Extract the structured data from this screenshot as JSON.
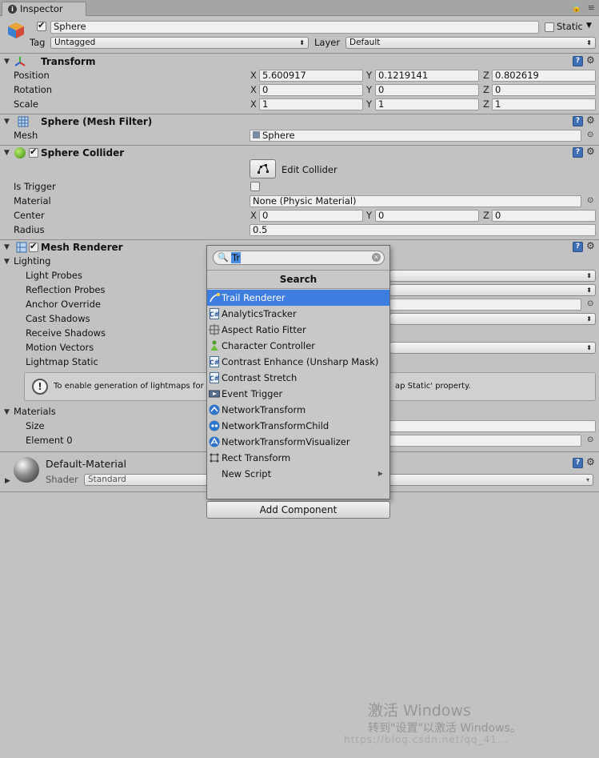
{
  "window": {
    "tab_label": "Inspector"
  },
  "object": {
    "name": "Sphere",
    "static_label": "Static",
    "tag_label": "Tag",
    "tag_value": "Untagged",
    "layer_label": "Layer",
    "layer_value": "Default"
  },
  "transform": {
    "title": "Transform",
    "rows": [
      {
        "label": "Position",
        "x": "5.600917",
        "y": "0.1219141",
        "z": "0.802619"
      },
      {
        "label": "Rotation",
        "x": "0",
        "y": "0",
        "z": "0"
      },
      {
        "label": "Scale",
        "x": "1",
        "y": "1",
        "z": "1"
      }
    ],
    "axes": {
      "x": "X",
      "y": "Y",
      "z": "Z"
    }
  },
  "mesh_filter": {
    "title": "Sphere (Mesh Filter)",
    "mesh_label": "Mesh",
    "mesh_value": "Sphere"
  },
  "sphere_collider": {
    "title": "Sphere Collider",
    "edit_label": "Edit Collider",
    "is_trigger_label": "Is Trigger",
    "material_label": "Material",
    "material_value": "None (Physic Material)",
    "center_label": "Center",
    "center": {
      "x": "0",
      "y": "0",
      "z": "0"
    },
    "radius_label": "Radius",
    "radius_value": "0.5"
  },
  "mesh_renderer": {
    "title": "Mesh Renderer",
    "lighting_label": "Lighting",
    "light_probes": "Light Probes",
    "reflection_probes": "Reflection Probes",
    "anchor_override": "Anchor Override",
    "cast_shadows": "Cast Shadows",
    "receive_shadows": "Receive Shadows",
    "motion_vectors": "Motion Vectors",
    "lightmap_static": "Lightmap Static",
    "info_left": "To enable generation of lightmaps for t",
    "info_right": "ap Static' property.",
    "materials_label": "Materials",
    "size_label": "Size",
    "element0_label": "Element 0"
  },
  "material": {
    "name": "Default-Material",
    "shader_label": "Shader",
    "shader_value": "Standard"
  },
  "popup": {
    "search_value": "Tr",
    "header": "Search",
    "items": [
      {
        "label": "Trail Renderer",
        "icon": "trail-renderer-icon",
        "selected": true
      },
      {
        "label": "AnalyticsTracker",
        "icon": "script-icon"
      },
      {
        "label": "Aspect Ratio Fitter",
        "icon": "aspect-ratio-icon"
      },
      {
        "label": "Character Controller",
        "icon": "character-controller-icon"
      },
      {
        "label": "Contrast Enhance (Unsharp Mask)",
        "icon": "script-icon"
      },
      {
        "label": "Contrast Stretch",
        "icon": "script-icon"
      },
      {
        "label": "Event Trigger",
        "icon": "event-trigger-icon"
      },
      {
        "label": "NetworkTransform",
        "icon": "network-icon"
      },
      {
        "label": "NetworkTransformChild",
        "icon": "network-icon"
      },
      {
        "label": "NetworkTransformVisualizer",
        "icon": "network-icon"
      },
      {
        "label": "Rect Transform",
        "icon": "rect-transform-icon"
      },
      {
        "label": "New Script",
        "icon": "",
        "submenu": true
      }
    ],
    "add_component": "Add Component"
  },
  "watermark": {
    "line1": "激活 Windows",
    "line2": "转到\"设置\"以激活 Windows。",
    "line3": "https://blog.csdn.net/qq_41..."
  },
  "colors": {
    "selection": "#3e7de0",
    "panel": "#c2c2c2",
    "help_icon": "#3f6fb4"
  }
}
